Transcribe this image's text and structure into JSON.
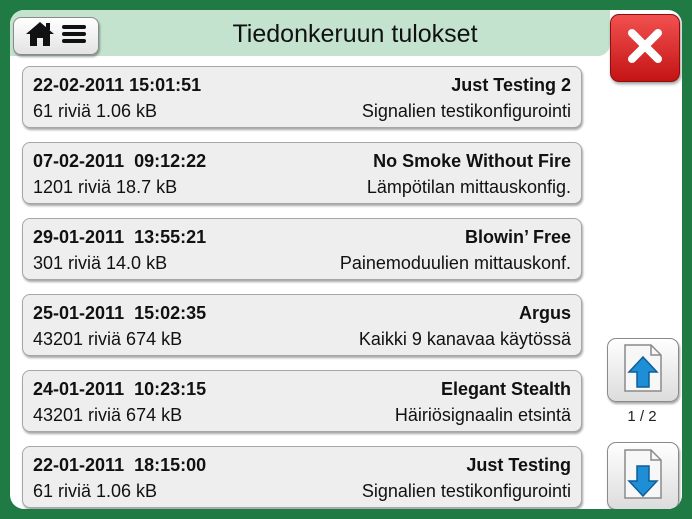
{
  "window": {
    "title": "Tiedonkeruun tulokset"
  },
  "header": {
    "home_icon": "home-icon",
    "menu_icon": "hamburger-menu-icon",
    "close_icon": "close-x-icon"
  },
  "results": [
    {
      "datetime": "22-02-2011 15:01:51",
      "name": "Just Testing 2",
      "info": "61 riviä 1.06 kB",
      "description": "Signalien testikonfigurointi"
    },
    {
      "datetime": "07-02-2011  09:12:22",
      "name": "No Smoke Without Fire",
      "info": "1201 riviä 18.7 kB",
      "description": "Lämpötilan mittauskonfig."
    },
    {
      "datetime": "29-01-2011  13:55:21",
      "name": "Blowin’ Free",
      "info": "301 riviä 14.0 kB",
      "description": "Painemoduulien mittauskonf."
    },
    {
      "datetime": "25-01-2011  15:02:35",
      "name": "Argus",
      "info": "43201 riviä 674 kB",
      "description": "Kaikki 9 kanavaa käytössä"
    },
    {
      "datetime": "24-01-2011  10:23:15",
      "name": "Elegant Stealth",
      "info": "43201 riviä 674 kB",
      "description": "Häiriösignaalin etsintä"
    },
    {
      "datetime": "22-01-2011  18:15:00",
      "name": "Just Testing",
      "info": "61 riviä 1.06 kB",
      "description": "Signalien testikonfigurointi"
    }
  ],
  "pagination": {
    "indicator": "1 / 2",
    "up_icon": "page-up-arrow-icon",
    "down_icon": "page-down-arrow-icon"
  },
  "colors": {
    "frame": "#1f7a44",
    "header": "#c4e3cf",
    "close": "#e02828",
    "arrow": "#1e8fd6"
  }
}
